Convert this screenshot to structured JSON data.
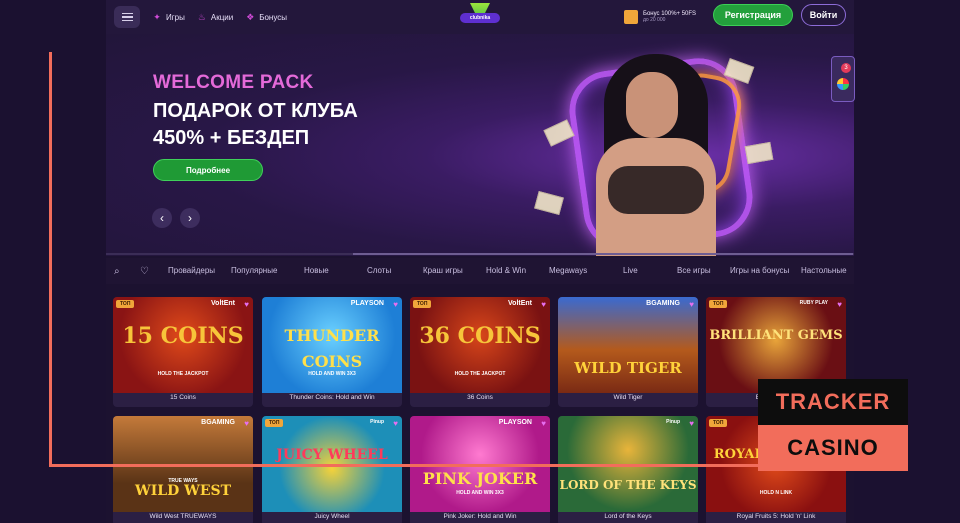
{
  "topbar": {
    "nav": [
      {
        "label": "Игры",
        "icon": "gamepad-icon"
      },
      {
        "label": "Акции",
        "icon": "fire-icon"
      },
      {
        "label": "Бонусы",
        "icon": "gift-icon"
      }
    ],
    "logo_text": "clubnika",
    "bonus_line1": "Бонус 100%+ 50FS",
    "bonus_line2": "до 20 000",
    "register_label": "Регистрация",
    "login_label": "Войти"
  },
  "hero": {
    "subtitle": "WELCOME PACK",
    "title_line1": "ПОДАРОК ОТ КЛУБА",
    "title_line2": "450% + БЕЗДЕП",
    "button_label": "Подробнее",
    "prev_arrow": "‹",
    "next_arrow": "›"
  },
  "side_widget": {
    "badge": "3"
  },
  "filters": [
    "Провайдеры",
    "Популярные",
    "Новые",
    "Слоты",
    "Краш игры",
    "Hold & Win",
    "Megaways",
    "Live",
    "Все игры",
    "Игры на бонусы",
    "Настольные"
  ],
  "games": [
    {
      "name": "15 Coins",
      "badge": "ТОП",
      "provider": "VoltEnt",
      "logo": "15 COINS",
      "sub": "HOLD THE JACKPOT",
      "bg": "#8a1414"
    },
    {
      "name": "Thunder Coins: Hold and Win",
      "badge": "",
      "provider": "PLAYSON",
      "logo": "THUNDER COINS",
      "sub": "HOLD AND WIN 3X3",
      "bg": "#1e7fd6"
    },
    {
      "name": "36 Coins",
      "badge": "ТОП",
      "provider": "VoltEnt",
      "logo": "36 COINS",
      "sub": "HOLD THE JACKPOT",
      "bg": "#7a1212"
    },
    {
      "name": "Wild Tiger",
      "badge": "",
      "provider": "BGAMING",
      "logo": "WILD TIGER",
      "sub": "",
      "bg": "#7a2a14"
    },
    {
      "name": "Brilliant Gems",
      "badge": "ТОП",
      "provider": "RUBY PLAY",
      "logo": "BRILLIANT GEMS",
      "sub": "",
      "bg": "#6a0f14"
    },
    {
      "name": "Wild West TRUEWAYS",
      "badge": "",
      "provider": "BGAMING",
      "logo": "WILD WEST",
      "sub": "TRUE WAYS",
      "bg": "#5a3316"
    },
    {
      "name": "Juicy Wheel",
      "badge": "ТОП",
      "provider": "Pinup",
      "logo": "JUICY WHEEL",
      "sub": "",
      "bg": "#1d8fb8"
    },
    {
      "name": "Pink Joker: Hold and Win",
      "badge": "",
      "provider": "PLAYSON",
      "logo": "PINK JOKER",
      "sub": "HOLD AND WIN 3X3",
      "bg": "#b01a8a"
    },
    {
      "name": "Lord of the Keys",
      "badge": "",
      "provider": "Pinup",
      "logo": "LORD OF THE KEYS",
      "sub": "",
      "bg": "#2a6a38"
    },
    {
      "name": "Royal Fruits 5: Hold 'n' Link",
      "badge": "ТОП",
      "provider": "",
      "logo": "ROYAL FRUITS 5",
      "sub": "HOLD N LINK",
      "bg": "#8a1010"
    }
  ],
  "watermark": {
    "line1": "TRACKER",
    "line2": "CASINO"
  },
  "colors": {
    "accent_green": "#23a03c",
    "accent_pink": "#e46ad9",
    "overlay": "#f26d5b"
  }
}
